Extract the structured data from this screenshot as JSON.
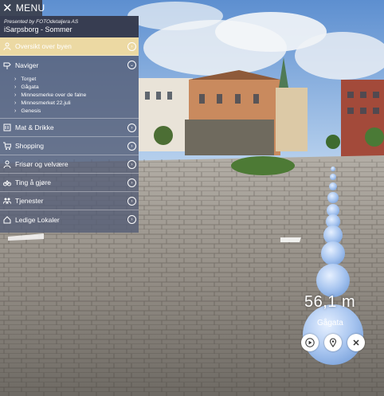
{
  "menu": {
    "label": "MENU",
    "close_icon": "close-icon"
  },
  "header": {
    "presented_by": "Presented by FOTOdetaljera AS",
    "place": "iSarpsborg - Sommer"
  },
  "nav": [
    {
      "label": "Oversikt over byen",
      "icon": "person-icon",
      "state": "active",
      "action_icon": "chevron-right-circle-icon"
    },
    {
      "label": "Naviger",
      "icon": "route-icon",
      "state": "expanded",
      "action_icon": "chevron-down-circle-icon",
      "children": [
        "Torget",
        "Gågata",
        "Minnesmerke over de falne",
        "Minnesmerket 22.juli",
        "Genesis"
      ]
    },
    {
      "label": "Mat & Drikke",
      "icon": "food-icon",
      "action_icon": "chevron-right-circle-icon"
    },
    {
      "label": "Shopping",
      "icon": "cart-icon",
      "action_icon": "chevron-right-circle-icon"
    },
    {
      "label": "Frisør og velvære",
      "icon": "person-icon",
      "action_icon": "chevron-right-circle-icon"
    },
    {
      "label": "Ting å gjøre",
      "icon": "bike-icon",
      "action_icon": "chevron-right-circle-icon"
    },
    {
      "label": "Tjenester",
      "icon": "people-icon",
      "action_icon": "chevron-right-circle-icon"
    },
    {
      "label": "Ledige Lokaler",
      "icon": "house-icon",
      "action_icon": "chevron-right-circle-icon"
    }
  ],
  "route": {
    "distance": "56,1 m",
    "target": "Gågata",
    "controls": [
      "play-icon",
      "location-pin-icon",
      "close-icon"
    ]
  },
  "colors": {
    "panel": "#545c76",
    "active": "#ecd9a3",
    "header": "#3d4556"
  }
}
